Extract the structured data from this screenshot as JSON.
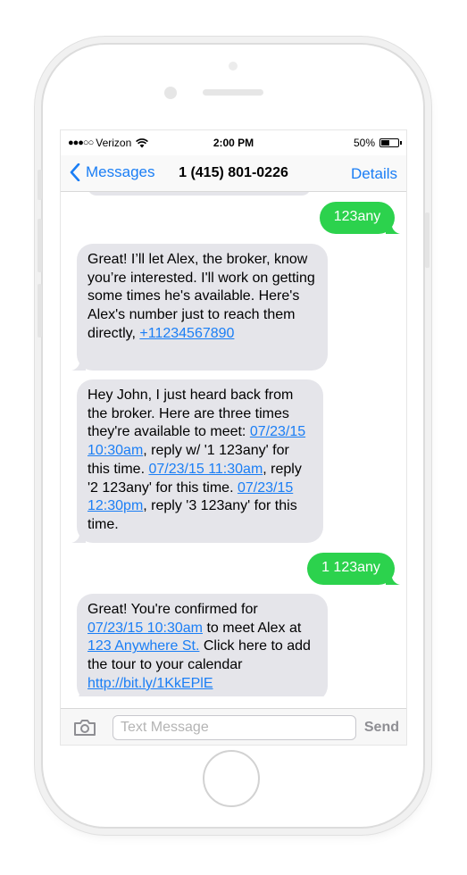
{
  "status_bar": {
    "signal": "●●●○○",
    "carrier": "Verizon",
    "time": "2:00 PM",
    "battery": "50%",
    "battery_level": 0.5
  },
  "nav": {
    "back_label": "Messages",
    "title": "1 (415) 801-0226",
    "details_label": "Details"
  },
  "messages": [
    {
      "from": "me",
      "text": "123any"
    },
    {
      "from": "them",
      "parts": [
        "Great! I’ll let Alex, the broker, know you’re interested. I'll work on getting some times he's available. Here's Alex's number just to reach them directly, ",
        "+11234567890"
      ]
    },
    {
      "from": "them",
      "parts": [
        "Hey John, I just heard back from the broker. Here are three times they're available to meet: ",
        "07/23/15 10:30am",
        ", reply w/ '1 123any' for this time. ",
        "07/23/15 11:30am",
        ", reply '2 123any' for this time. ",
        "07/23/15 12:30pm",
        ", reply '3 123any' for this time."
      ]
    },
    {
      "from": "me",
      "text": "1 123any"
    },
    {
      "from": "them",
      "parts": [
        "Great! You're confirmed for ",
        "07/23/15 10:30am",
        " to meet Alex at ",
        "123 Anywhere St.",
        " Click here to add the tour to your calendar ",
        "http://bit.ly/1KkEPlE"
      ]
    }
  ],
  "input_bar": {
    "placeholder": "Text Message",
    "send_label": "Send"
  },
  "colors": {
    "ios_blue": "#1a7ef5",
    "sent_bubble": "#2cd24d",
    "received_bubble": "#e5e5ea"
  },
  "icons": [
    "wifi-icon",
    "battery-icon",
    "chevron-left-icon",
    "camera-icon"
  ]
}
